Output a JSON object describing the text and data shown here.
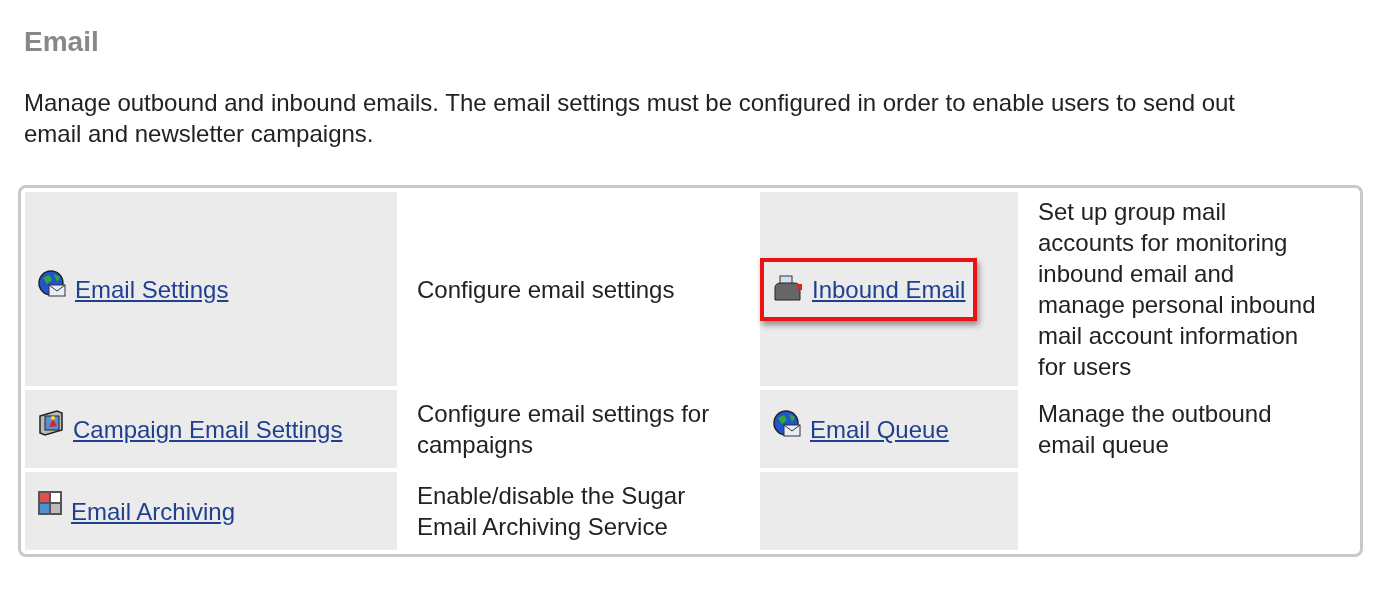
{
  "title": "Email",
  "description": "Manage outbound and inbound emails. The email settings must be configured in order to enable users to send out email and newsletter campaigns.",
  "rows": [
    {
      "items": [
        {
          "kind": "globe-mail",
          "link": "Email Settings",
          "description": "Configure email settings",
          "highlighted": false
        },
        {
          "kind": "mailbox",
          "link": "Inbound Email",
          "description": "Set up group mail accounts for monitoring inbound email and manage personal inbound mail account information for users",
          "highlighted": true
        }
      ]
    },
    {
      "items": [
        {
          "kind": "monitor",
          "link": "Campaign Email Settings",
          "description": "Configure email settings for campaigns",
          "highlighted": false
        },
        {
          "kind": "globe-mail",
          "link": "Email Queue",
          "description": "Manage the outbound email queue",
          "highlighted": false
        }
      ]
    },
    {
      "items": [
        {
          "kind": "grid",
          "link": "Email Archiving",
          "description": "Enable/disable the Sugar Email Archiving Service",
          "highlighted": false
        }
      ]
    }
  ]
}
